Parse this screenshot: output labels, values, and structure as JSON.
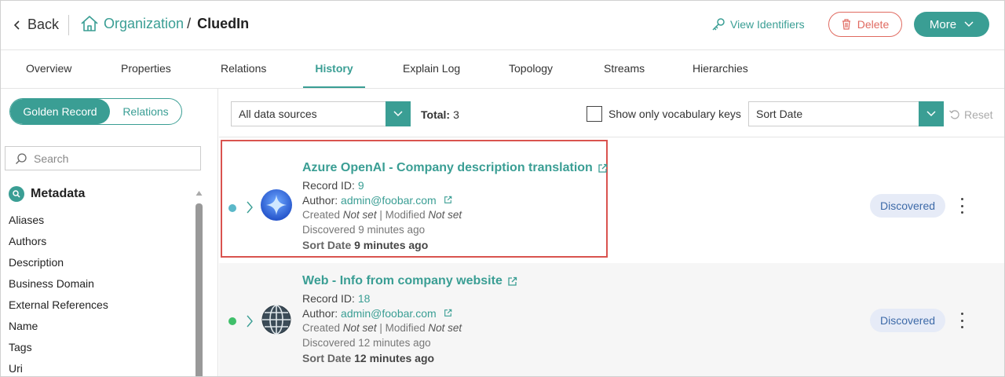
{
  "header": {
    "back_label": "Back",
    "breadcrumb_parent": "Organization",
    "breadcrumb_sep": "/",
    "breadcrumb_current": "CluedIn",
    "view_identifiers_label": "View Identifiers",
    "delete_label": "Delete",
    "more_label": "More"
  },
  "tabs": [
    {
      "label": "Overview"
    },
    {
      "label": "Properties"
    },
    {
      "label": "Relations"
    },
    {
      "label": "History",
      "active": true
    },
    {
      "label": "Explain Log"
    },
    {
      "label": "Topology"
    },
    {
      "label": "Streams"
    },
    {
      "label": "Hierarchies"
    }
  ],
  "sidebar": {
    "toggle_on": "Golden Record",
    "toggle_off": "Relations",
    "search_placeholder": "Search",
    "metadata_title": "Metadata",
    "items": [
      "Aliases",
      "Authors",
      "Description",
      "Business Domain",
      "External References",
      "Name",
      "Tags",
      "Uri"
    ]
  },
  "toolbar": {
    "source_select_value": "All data sources",
    "total_label": "Total:",
    "total_value": "3",
    "vocab_checkbox_label": "Show only vocabulary keys",
    "vocab_checked": false,
    "sort_select_value": "Sort Date",
    "reset_label": "Reset"
  },
  "records": [
    {
      "title": "Azure OpenAI - Company description translation",
      "record_id_label": "Record ID:",
      "record_id": "9",
      "author_label": "Author:",
      "author": "admin@foobar.com",
      "created_label": "Created",
      "created_value": "Not set",
      "modified_label": "| Modified",
      "modified_value": "Not set",
      "discovered": "Discovered 9 minutes ago",
      "sort_label": "Sort Date",
      "sort_value": "9 minutes ago",
      "status": "Discovered",
      "dot_color": "#5bb8c9",
      "icon": "openai-sparkle-icon",
      "highlighted": true
    },
    {
      "title": "Web - Info from company website",
      "record_id_label": "Record ID:",
      "record_id": "18",
      "author_label": "Author:",
      "author": "admin@foobar.com",
      "created_label": "Created",
      "created_value": "Not set",
      "modified_label": "| Modified",
      "modified_value": "Not set",
      "discovered": "Discovered 12 minutes ago",
      "sort_label": "Sort Date",
      "sort_value": "12 minutes ago",
      "status": "Discovered",
      "dot_color": "#3fbf6a",
      "icon": "globe-icon",
      "highlighted": false
    }
  ],
  "colors": {
    "accent": "#3a9e94",
    "danger": "#e06a60",
    "highlight_border": "#d9534f",
    "badge_bg": "#e6ebf7",
    "badge_text": "#3d6aa8"
  }
}
